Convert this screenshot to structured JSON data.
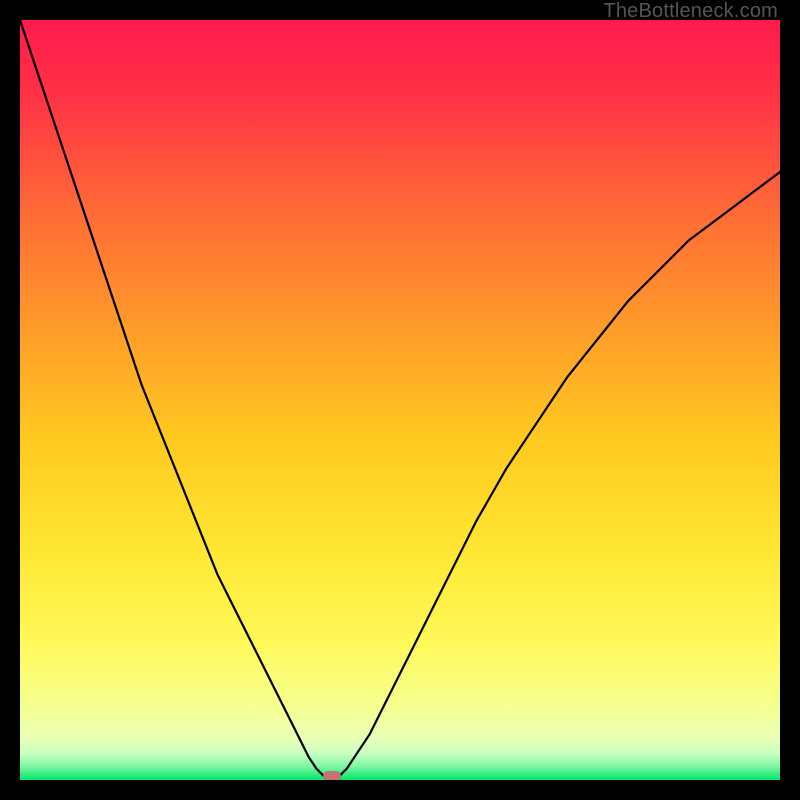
{
  "watermark": "TheBottleneck.com",
  "colors": {
    "frame": "#000000",
    "curve": "#000000",
    "marker": "#c77171",
    "green_bottom": "#00e86b",
    "gradient_stops": [
      {
        "offset": 0.0,
        "color": "#ff1a4d"
      },
      {
        "offset": 0.1,
        "color": "#ff3246"
      },
      {
        "offset": 0.25,
        "color": "#ff6a36"
      },
      {
        "offset": 0.4,
        "color": "#ff9a2a"
      },
      {
        "offset": 0.55,
        "color": "#ffc91f"
      },
      {
        "offset": 0.7,
        "color": "#ffe733"
      },
      {
        "offset": 0.82,
        "color": "#fff95a"
      },
      {
        "offset": 0.9,
        "color": "#f6ff8e"
      },
      {
        "offset": 0.945,
        "color": "#eaffb4"
      },
      {
        "offset": 0.965,
        "color": "#c9ffc0"
      },
      {
        "offset": 0.982,
        "color": "#7df7a3"
      },
      {
        "offset": 1.0,
        "color": "#00e86b"
      }
    ]
  },
  "chart_data": {
    "type": "line",
    "title": "",
    "xlabel": "",
    "ylabel": "",
    "xlim": [
      0,
      100
    ],
    "ylim": [
      0,
      100
    ],
    "x": [
      0,
      2,
      4,
      6,
      8,
      10,
      12,
      14,
      16,
      18,
      20,
      22,
      24,
      26,
      28,
      30,
      32,
      34,
      36,
      37,
      38,
      39,
      40,
      41,
      42,
      43,
      44,
      46,
      48,
      50,
      52,
      54,
      56,
      58,
      60,
      62,
      64,
      66,
      68,
      70,
      72,
      74,
      76,
      78,
      80,
      82,
      84,
      86,
      88,
      90,
      92,
      94,
      96,
      98,
      100
    ],
    "y": [
      100,
      94,
      88,
      82,
      76,
      70,
      64,
      58,
      52,
      47,
      42,
      37,
      32,
      27,
      23,
      19,
      15,
      11,
      7,
      5,
      3,
      1.5,
      0.5,
      0,
      0.5,
      1.5,
      3,
      6,
      10,
      14,
      18,
      22,
      26,
      30,
      34,
      37.5,
      41,
      44,
      47,
      50,
      53,
      55.5,
      58,
      60.5,
      63,
      65,
      67,
      69,
      71,
      72.5,
      74,
      75.5,
      77,
      78.5,
      80
    ],
    "minimum_marker": {
      "x": 41,
      "y": 0
    },
    "notes": "V-shaped bottleneck curve; y is mismatch percentage (0 = optimal). Values read from pixel positions, approximate to ±2."
  }
}
